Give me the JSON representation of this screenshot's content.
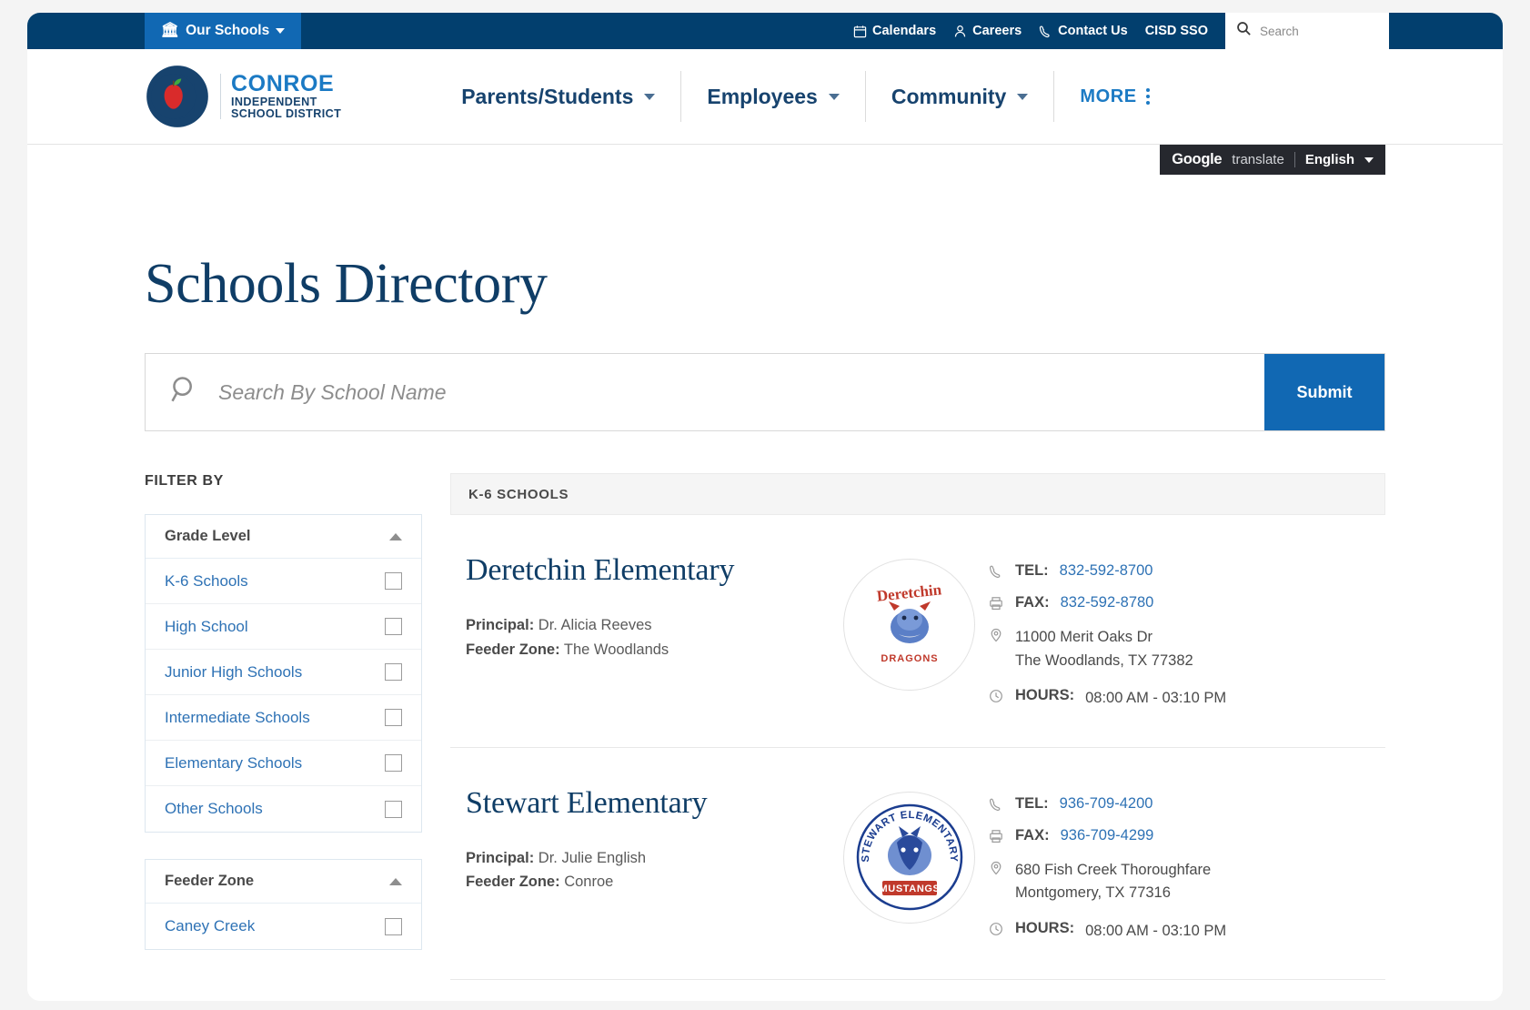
{
  "utility_bar": {
    "our_schools": "Our Schools",
    "links": [
      {
        "label": "Calendars",
        "icon": "calendar-icon"
      },
      {
        "label": "Careers",
        "icon": "person-icon"
      },
      {
        "label": "Contact Us",
        "icon": "phone-icon"
      },
      {
        "label": "CISD SSO",
        "icon": ""
      }
    ],
    "search_placeholder": "Search"
  },
  "logo": {
    "line1": "CONROE",
    "line2": "INDEPENDENT",
    "line3": "SCHOOL DISTRICT"
  },
  "main_nav": {
    "items": [
      {
        "label": "Parents/Students"
      },
      {
        "label": "Employees"
      },
      {
        "label": "Community"
      }
    ],
    "more": "MORE"
  },
  "translate": {
    "google": "Google",
    "translate": "translate",
    "language": "English"
  },
  "page": {
    "title": "Schools Directory",
    "search_placeholder": "Search By School Name",
    "submit_label": "Submit"
  },
  "filters": {
    "heading": "FILTER BY",
    "groups": [
      {
        "title": "Grade Level",
        "options": [
          {
            "label": "K-6 Schools",
            "checked": false
          },
          {
            "label": "High School",
            "checked": false
          },
          {
            "label": "Junior High Schools",
            "checked": false
          },
          {
            "label": "Intermediate Schools",
            "checked": false
          },
          {
            "label": "Elementary Schools",
            "checked": false
          },
          {
            "label": "Other Schools",
            "checked": false
          }
        ]
      },
      {
        "title": "Feeder Zone",
        "options": [
          {
            "label": "Caney Creek",
            "checked": false
          }
        ]
      }
    ]
  },
  "results": {
    "section_header": "K-6 SCHOOLS",
    "labels": {
      "principal": "Principal:",
      "feeder_zone": "Feeder Zone:",
      "tel": "TEL:",
      "fax": "FAX:",
      "hours": "HOURS:"
    },
    "schools": [
      {
        "name": "Deretchin Elementary",
        "principal": "Dr. Alicia Reeves",
        "feeder_zone": "The Woodlands",
        "tel": "832-592-8700",
        "fax": "832-592-8780",
        "address_line1": "11000 Merit Oaks Dr",
        "address_line2": "The Woodlands, TX  77382",
        "hours": "08:00 AM - 03:10 PM",
        "logo_top": "Deretchin",
        "logo_bottom": "DRAGONS"
      },
      {
        "name": "Stewart Elementary",
        "principal": "Dr. Julie English",
        "feeder_zone": "Conroe",
        "tel": "936-709-4200",
        "fax": "936-709-4299",
        "address_line1": "680 Fish Creek Thoroughfare",
        "address_line2": "Montgomery, TX  77316",
        "hours": "08:00 AM - 03:10 PM",
        "logo_top": "STEWART ELEMENTARY",
        "logo_bottom": "MUSTANGS"
      }
    ]
  },
  "colors": {
    "navy": "#023f6e",
    "blue": "#1168b3",
    "link_blue": "#2e72b5",
    "heading_navy": "#0f3d66"
  }
}
